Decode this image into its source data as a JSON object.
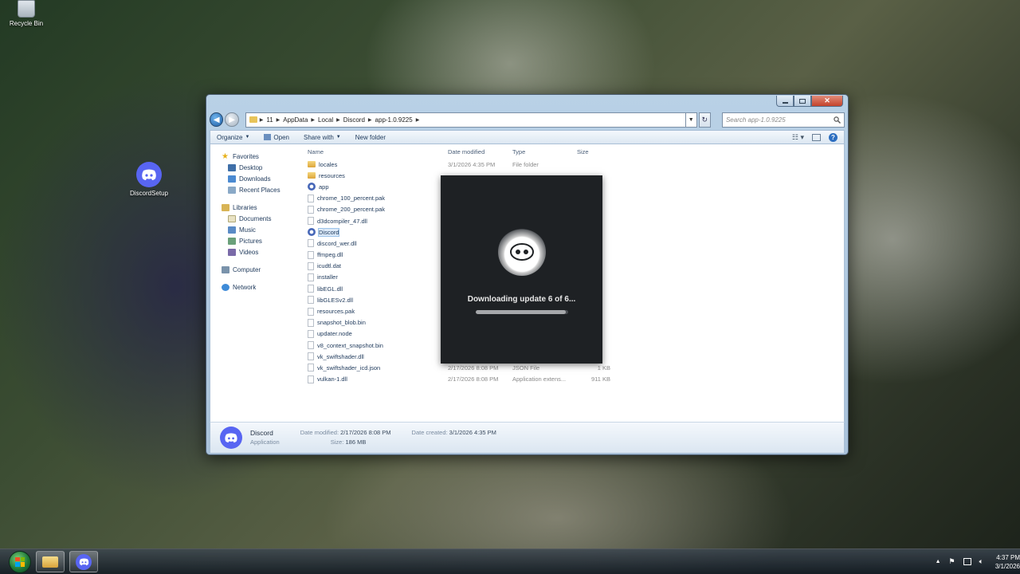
{
  "desktop": {
    "icons": [
      {
        "label": "Recycle Bin"
      },
      {
        "label": "DiscordSetup"
      }
    ]
  },
  "window": {
    "address": {
      "crumbs": [
        "11",
        "AppData",
        "Local",
        "Discord",
        "app-1.0.9225"
      ]
    },
    "search_placeholder": "Search app-1.0.9225",
    "toolbar": {
      "organize": "Organize",
      "open": "Open",
      "share_with": "Share with",
      "new_folder": "New folder"
    },
    "nav": {
      "favorites": "Favorites",
      "desktop": "Desktop",
      "downloads": "Downloads",
      "recent_places": "Recent Places",
      "libraries": "Libraries",
      "documents": "Documents",
      "music": "Music",
      "pictures": "Pictures",
      "videos": "Videos",
      "computer": "Computer",
      "network": "Network"
    },
    "columns": {
      "name": "Name",
      "date_modified": "Date modified",
      "type": "Type",
      "size": "Size"
    },
    "files": [
      {
        "name": "locales",
        "icon": "folder",
        "date": "3/1/2026 4:35 PM",
        "type": "File folder",
        "size": ""
      },
      {
        "name": "resources",
        "icon": "folder",
        "date": "",
        "type": "",
        "size": ""
      },
      {
        "name": "app",
        "icon": "app",
        "date": "",
        "type": "",
        "size": ""
      },
      {
        "name": "chrome_100_percent.pak",
        "icon": "file",
        "date": "",
        "type": "",
        "size": ""
      },
      {
        "name": "chrome_200_percent.pak",
        "icon": "file",
        "date": "",
        "type": "",
        "size": ""
      },
      {
        "name": "d3dcompiler_47.dll",
        "icon": "file",
        "date": "",
        "type": "",
        "size": ""
      },
      {
        "name": "Discord",
        "icon": "app",
        "date": "",
        "type": "",
        "size": ""
      },
      {
        "name": "discord_wer.dll",
        "icon": "file",
        "date": "",
        "type": "",
        "size": ""
      },
      {
        "name": "ffmpeg.dll",
        "icon": "file",
        "date": "",
        "type": "",
        "size": ""
      },
      {
        "name": "icudtl.dat",
        "icon": "file",
        "date": "",
        "type": "",
        "size": ""
      },
      {
        "name": "installer",
        "icon": "file",
        "date": "",
        "type": "",
        "size": ""
      },
      {
        "name": "libEGL.dll",
        "icon": "file",
        "date": "",
        "type": "",
        "size": ""
      },
      {
        "name": "libGLESv2.dll",
        "icon": "file",
        "date": "",
        "type": "",
        "size": ""
      },
      {
        "name": "resources.pak",
        "icon": "file",
        "date": "",
        "type": "",
        "size": ""
      },
      {
        "name": "snapshot_blob.bin",
        "icon": "file",
        "date": "",
        "type": "",
        "size": ""
      },
      {
        "name": "updater.node",
        "icon": "file",
        "date": "",
        "type": "",
        "size": ""
      },
      {
        "name": "v8_context_snapshot.bin",
        "icon": "file",
        "date": "",
        "type": "",
        "size": ""
      },
      {
        "name": "vk_swiftshader.dll",
        "icon": "file",
        "date": "",
        "type": "",
        "size": ""
      },
      {
        "name": "vk_swiftshader_icd.json",
        "icon": "file",
        "date": "2/17/2026 8:08 PM",
        "type": "JSON File",
        "size": "1 KB"
      },
      {
        "name": "vulkan-1.dll",
        "icon": "file",
        "date": "2/17/2026 8:08 PM",
        "type": "Application extens...",
        "size": "911 KB"
      }
    ],
    "details": {
      "name": "Discord",
      "kind": "Application",
      "date_modified_label": "Date modified:",
      "date_modified": "2/17/2026 8:08 PM",
      "size_label": "Size:",
      "size": "186 MB",
      "date_created_label": "Date created:",
      "date_created": "3/1/2026 4:35 PM"
    }
  },
  "splash": {
    "status": "Downloading update 6 of 6...",
    "progress": 0.98
  },
  "taskbar": {
    "time": "4:37 PM",
    "date": "3/1/2026"
  },
  "colors": {
    "discord_blurple": "#5865f2",
    "splash_bg": "#1e2124"
  }
}
